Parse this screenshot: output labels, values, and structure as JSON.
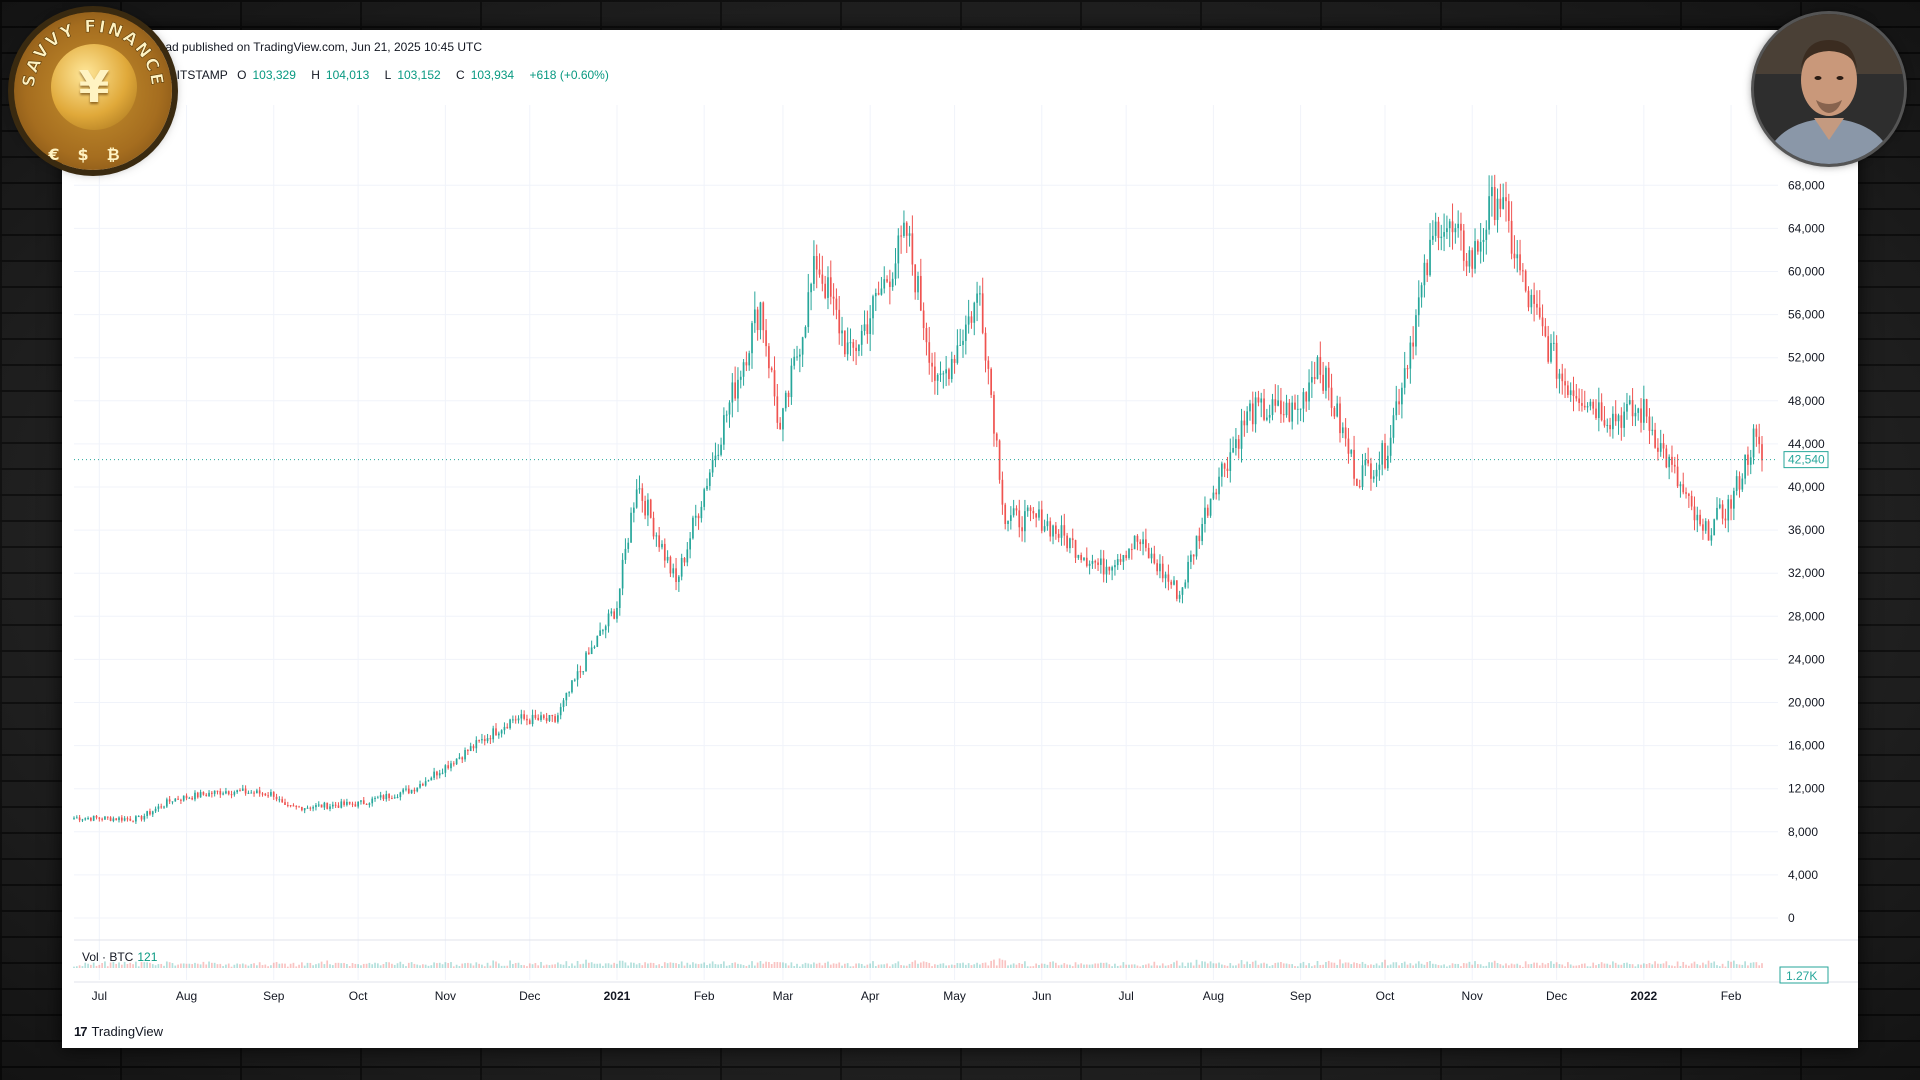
{
  "header": {
    "published_line": "umar farooq ahmad published on TradingView.com, Jun 21, 2025 10:45 UTC",
    "symbol_info": "U.S. Dollar · 1D · BITSTAMP",
    "open_key": "O",
    "open": "103,329",
    "high_key": "H",
    "high": "104,013",
    "low_key": "L",
    "low": "103,152",
    "close_key": "C",
    "close": "103,934",
    "change": "+618 (+0.60%)"
  },
  "volume": {
    "label": "Vol · BTC",
    "value": "121",
    "axis_label": "1.27K"
  },
  "branding": {
    "tradingview": "TradingView",
    "logo_mark": "17",
    "badge_text": "SAVVY FINANCE",
    "badge_center": "¥",
    "badge_symbols": "€$₿"
  },
  "colors": {
    "up": "#26a69a",
    "down": "#ef5350",
    "text": "#131722",
    "grid": "#f0f3fa",
    "last_price_label": "#26a69a"
  },
  "chart_data": {
    "type": "candlestick",
    "title": "",
    "xlabel": "",
    "ylabel": "",
    "x_ticks": [
      "Jul",
      "Aug",
      "Sep",
      "Oct",
      "Nov",
      "Dec",
      "2021",
      "Feb",
      "Mar",
      "Apr",
      "May",
      "Jun",
      "Jul",
      "Aug",
      "Sep",
      "Oct",
      "Nov",
      "Dec",
      "2022",
      "Feb"
    ],
    "x_range": [
      "2020-06-22",
      "2022-02-12"
    ],
    "y_ticks": [
      0,
      4000,
      8000,
      12000,
      16000,
      20000,
      24000,
      28000,
      32000,
      36000,
      40000,
      44000,
      48000,
      52000,
      56000,
      60000,
      64000,
      68000
    ],
    "y_tick_labels": [
      "0",
      "4,000",
      "8,000",
      "12,000",
      "16,000",
      "20,000",
      "24,000",
      "28,000",
      "32,000",
      "36,000",
      "40,000",
      "44,000",
      "48,000",
      "52,000",
      "56,000",
      "60,000",
      "64,000",
      "68,000"
    ],
    "ylim": [
      0,
      68000
    ],
    "last_price": 42540,
    "last_price_label": "42,540",
    "close_path": [
      [
        "2020-06-22",
        9300
      ],
      [
        "2020-07-15",
        9200
      ],
      [
        "2020-07-27",
        11000
      ],
      [
        "2020-08-15",
        11800
      ],
      [
        "2020-09-01",
        11500
      ],
      [
        "2020-09-05",
        10200
      ],
      [
        "2020-10-01",
        10600
      ],
      [
        "2020-10-20",
        11900
      ],
      [
        "2020-11-05",
        14800
      ],
      [
        "2020-11-25",
        18500
      ],
      [
        "2020-12-10",
        18300
      ],
      [
        "2020-12-20",
        23500
      ],
      [
        "2021-01-01",
        29000
      ],
      [
        "2021-01-08",
        40500
      ],
      [
        "2021-01-22",
        31000
      ],
      [
        "2021-02-08",
        46000
      ],
      [
        "2021-02-21",
        57000
      ],
      [
        "2021-02-28",
        45000
      ],
      [
        "2021-03-13",
        61000
      ],
      [
        "2021-03-25",
        52000
      ],
      [
        "2021-04-14",
        63500
      ],
      [
        "2021-04-25",
        49000
      ],
      [
        "2021-05-10",
        58000
      ],
      [
        "2021-05-19",
        37000
      ],
      [
        "2021-06-01",
        37000
      ],
      [
        "2021-06-22",
        32500
      ],
      [
        "2021-07-05",
        35000
      ],
      [
        "2021-07-20",
        30000
      ],
      [
        "2021-08-01",
        40000
      ],
      [
        "2021-08-14",
        47000
      ],
      [
        "2021-08-31",
        47000
      ],
      [
        "2021-09-07",
        52000
      ],
      [
        "2021-09-21",
        41000
      ],
      [
        "2021-10-01",
        43000
      ],
      [
        "2021-10-20",
        65000
      ],
      [
        "2021-11-01",
        61000
      ],
      [
        "2021-11-10",
        67500
      ],
      [
        "2021-11-20",
        58000
      ],
      [
        "2021-12-03",
        50000
      ],
      [
        "2021-12-20",
        46500
      ],
      [
        "2022-01-01",
        47000
      ],
      [
        "2022-01-22",
        35500
      ],
      [
        "2022-02-01",
        38500
      ],
      [
        "2022-02-09",
        44500
      ],
      [
        "2022-02-12",
        42540
      ]
    ],
    "grid": true,
    "volume_pane": true
  }
}
